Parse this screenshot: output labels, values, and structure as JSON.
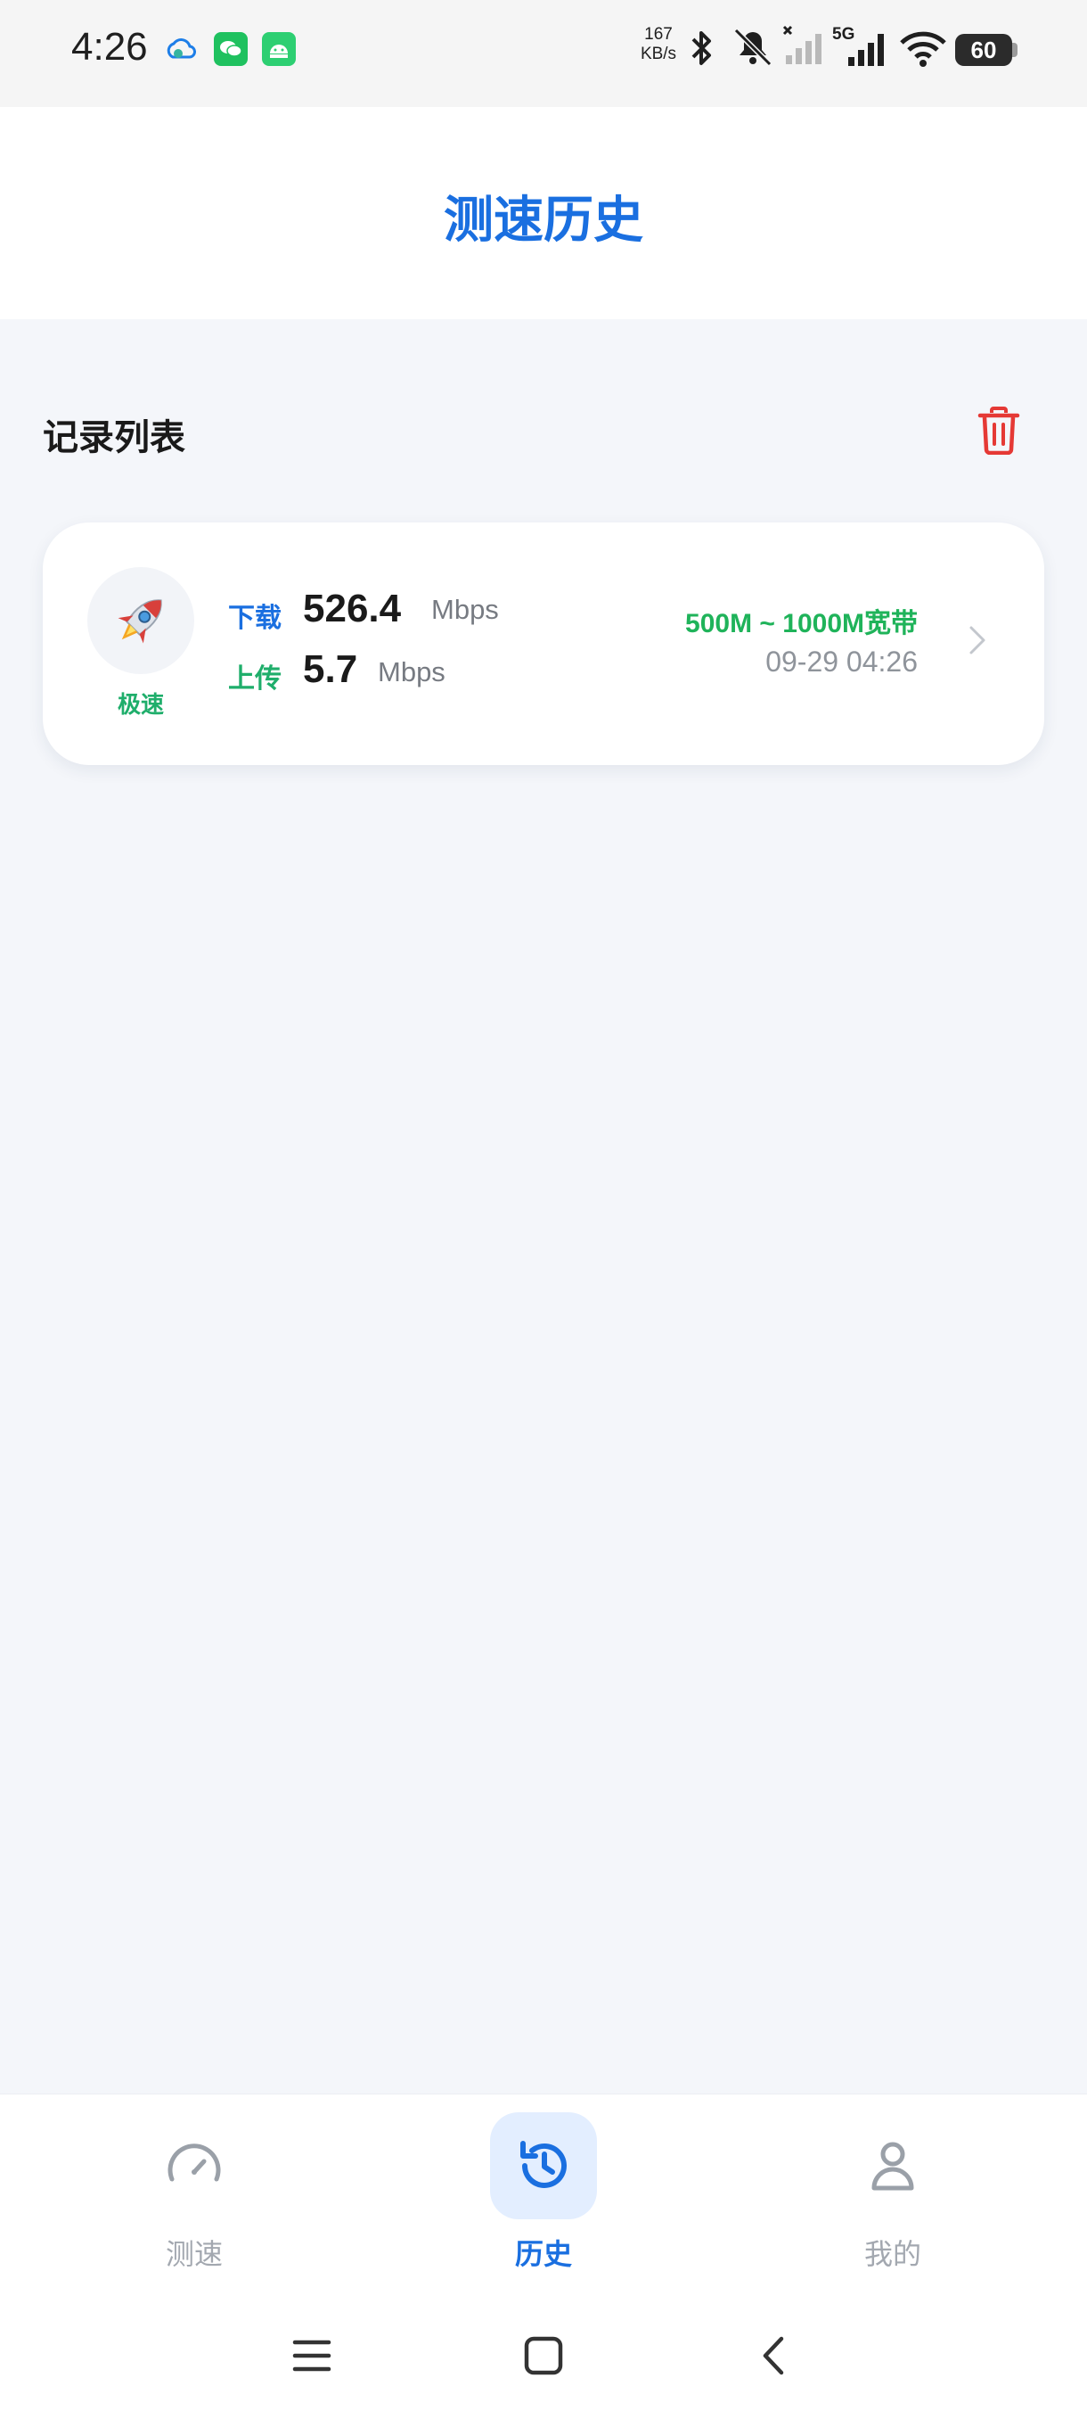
{
  "status_bar": {
    "time": "4:26",
    "net_speed_value": "167",
    "net_speed_unit": "KB/s",
    "network_type": "5G",
    "battery": "60",
    "icons": [
      "cloud-icon",
      "wechat-icon",
      "android-icon",
      "bluetooth-icon",
      "mute-icon",
      "signal-icon",
      "wifi-icon",
      "battery-icon"
    ]
  },
  "header": {
    "title": "测速历史"
  },
  "records_section": {
    "title": "记录列表",
    "delete_icon": "trash-icon",
    "delete_color": "#e53935"
  },
  "records": [
    {
      "icon": "rocket-icon",
      "level": "极速",
      "download_label": "下载",
      "download_value": "526.4",
      "download_unit": "Mbps",
      "upload_label": "上传",
      "upload_value": "5.7",
      "upload_unit": "Mbps",
      "bandwidth": "500M ~ 1000M宽带",
      "time": "09-29 04:26"
    }
  ],
  "bottom_nav": {
    "items": [
      {
        "label": "测速",
        "icon": "speedometer-icon",
        "active": false
      },
      {
        "label": "历史",
        "icon": "history-icon",
        "active": true
      },
      {
        "label": "我的",
        "icon": "user-icon",
        "active": false
      }
    ]
  },
  "system_nav": [
    "menu-icon",
    "home-icon",
    "back-icon"
  ],
  "colors": {
    "accent": "#1a6fe0",
    "download": "#1a6fe0",
    "upload": "#1fae6b",
    "bandwidth": "#1fb35a",
    "background": "#f4f6fa"
  }
}
